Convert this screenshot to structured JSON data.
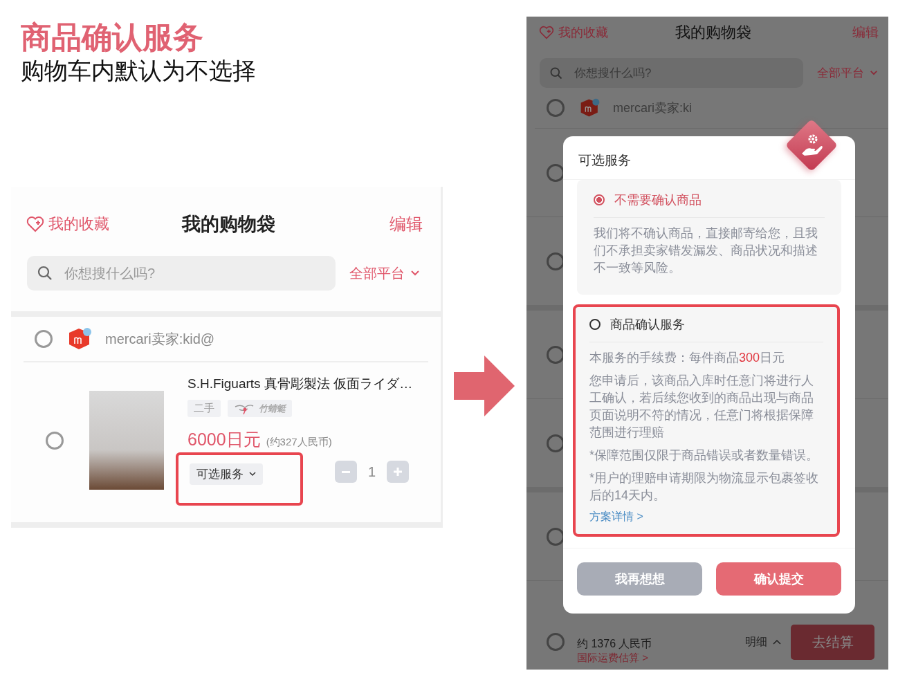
{
  "heading": {
    "title": "商品确认服务",
    "subtitle": "购物车内默认为不选择"
  },
  "cart_before": {
    "header": {
      "favorites": "我的收藏",
      "title": "我的购物袋",
      "edit": "编辑"
    },
    "search": {
      "placeholder": "你想搜什么吗?"
    },
    "platform_filter": "全部平台",
    "seller": {
      "name": "mercari卖家:kid@",
      "selected": false
    },
    "item": {
      "selected": false,
      "title": "S.H.Figuarts 真骨彫製法 仮面ライダ…",
      "tags": [
        {
          "kind": "text",
          "label": "二手"
        },
        {
          "kind": "brand",
          "label": "竹蜻蜓"
        }
      ],
      "price": "6000日元",
      "price_cny": "(约327人民币)",
      "service_button": "可选服务",
      "service_highlighted": true,
      "quantity": "1"
    }
  },
  "cart_after": {
    "header": {
      "favorites": "我的收藏",
      "title": "我的购物袋",
      "edit": "编辑"
    },
    "search": {
      "placeholder": "你想搜什么吗?"
    },
    "platform_filter": "全部平台",
    "seller": {
      "name": "mercari卖家:ki",
      "selected": false
    },
    "rows": [
      {
        "selected": false
      },
      {
        "selected": false
      },
      {
        "selected": false
      },
      {
        "selected": false
      },
      {
        "selected": false
      }
    ],
    "footer": {
      "selected": false,
      "approx": "约 1376 人民币",
      "shipping_link": "国际运费估算 >",
      "details": "明细",
      "checkout": "去结算"
    },
    "dialog": {
      "title": "可选服务",
      "options": [
        {
          "label": "不需要确认商品",
          "selected": true,
          "highlighted": false,
          "paragraphs": [
            [
              {
                "text": "我们将不确认商品，直接邮寄给您，且我们不承担卖家错发漏发、商品状况和描述不一致等风险。",
                "emphasis": false
              }
            ]
          ]
        },
        {
          "label": "商品确认服务",
          "selected": false,
          "highlighted": true,
          "paragraphs": [
            [
              {
                "text": "本服务的手续费：每件商品",
                "emphasis": false
              },
              {
                "text": "300",
                "emphasis": true
              },
              {
                "text": "日元",
                "emphasis": false
              }
            ],
            [
              {
                "text": "您申请后，该商品入库时任意门将进行人工确认，若后续您收到的商品出现与商品页面说明不符的情况，任意门将根据保障范围进行理赔",
                "emphasis": false
              }
            ],
            [
              {
                "text": "*保障范围仅限于商品错误或者数量错误。",
                "emphasis": false
              }
            ],
            [
              {
                "text": "*用户的理赔申请期限为物流显示包裹签收后的14天内。",
                "emphasis": false
              }
            ]
          ],
          "link": "方案详情 >"
        }
      ],
      "buttons": [
        {
          "kind": "secondary",
          "label": "我再想想"
        },
        {
          "kind": "primary",
          "label": "确认提交"
        }
      ]
    }
  }
}
